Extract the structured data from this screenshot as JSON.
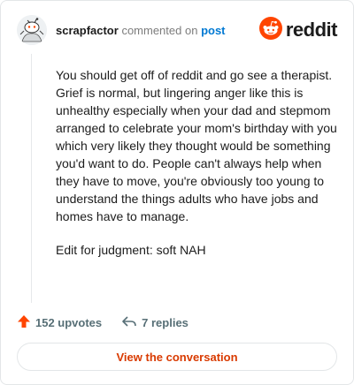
{
  "header": {
    "username": "scrapfactor",
    "action_text": "commented on",
    "target_link": "post",
    "brand_name": "reddit"
  },
  "comment": {
    "paragraphs": [
      "You should get off of reddit and go see a therapist. Grief is normal, but lingering anger like this is unhealthy especially when your dad and stepmom arranged to celebrate your mom's birthday with you which very likely they thought would be something you'd want to do. People can't always help when they have to move, you're obviously too young to understand the things adults who have jobs and homes have to manage.",
      "Edit for judgment: soft NAH"
    ]
  },
  "footer": {
    "upvotes_label": "152 upvotes",
    "replies_label": "7 replies",
    "cta_label": "View the conversation"
  },
  "icons": {
    "avatar": "snoo-avatar-icon",
    "brand": "reddit-logo-icon",
    "upvote": "upvote-arrow-icon",
    "reply": "reply-arrow-icon"
  },
  "colors": {
    "brand_orange": "#ff4500",
    "link_blue": "#0079d3",
    "cta_text": "#d93a00",
    "muted": "#576f76"
  }
}
